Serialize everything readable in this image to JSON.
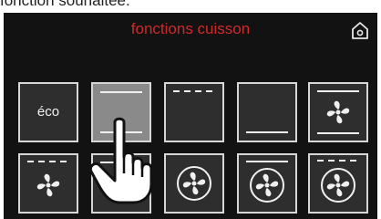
{
  "caption": "fonction souhaitée.",
  "header": {
    "title": "fonctions cuisson",
    "title_color": "#cf2a2a",
    "home_icon": "home-icon"
  },
  "tiles_row1": [
    {
      "name": "tile-eco",
      "label": "éco"
    },
    {
      "name": "tile-top-bottom-heat",
      "icon": "top-bottom-heat-icon",
      "selected": true
    },
    {
      "name": "tile-top-heat-dashed",
      "icon": "top-heat-dashed-icon"
    },
    {
      "name": "tile-bottom-heat",
      "icon": "bottom-heat-icon"
    },
    {
      "name": "tile-fan-top-bottom",
      "icon": "fan-icon"
    }
  ],
  "tiles_row2": [
    {
      "name": "tile-fan-top-dashed",
      "icon": "fan-icon"
    },
    {
      "name": "tile-fan-hidden",
      "icon": "fan-icon"
    },
    {
      "name": "tile-fan",
      "icon": "fan-icon"
    },
    {
      "name": "tile-fan-top",
      "icon": "fan-icon"
    },
    {
      "name": "tile-fan-top-dashed-2",
      "icon": "fan-icon"
    }
  ],
  "pointer": "hand-pointer-icon"
}
